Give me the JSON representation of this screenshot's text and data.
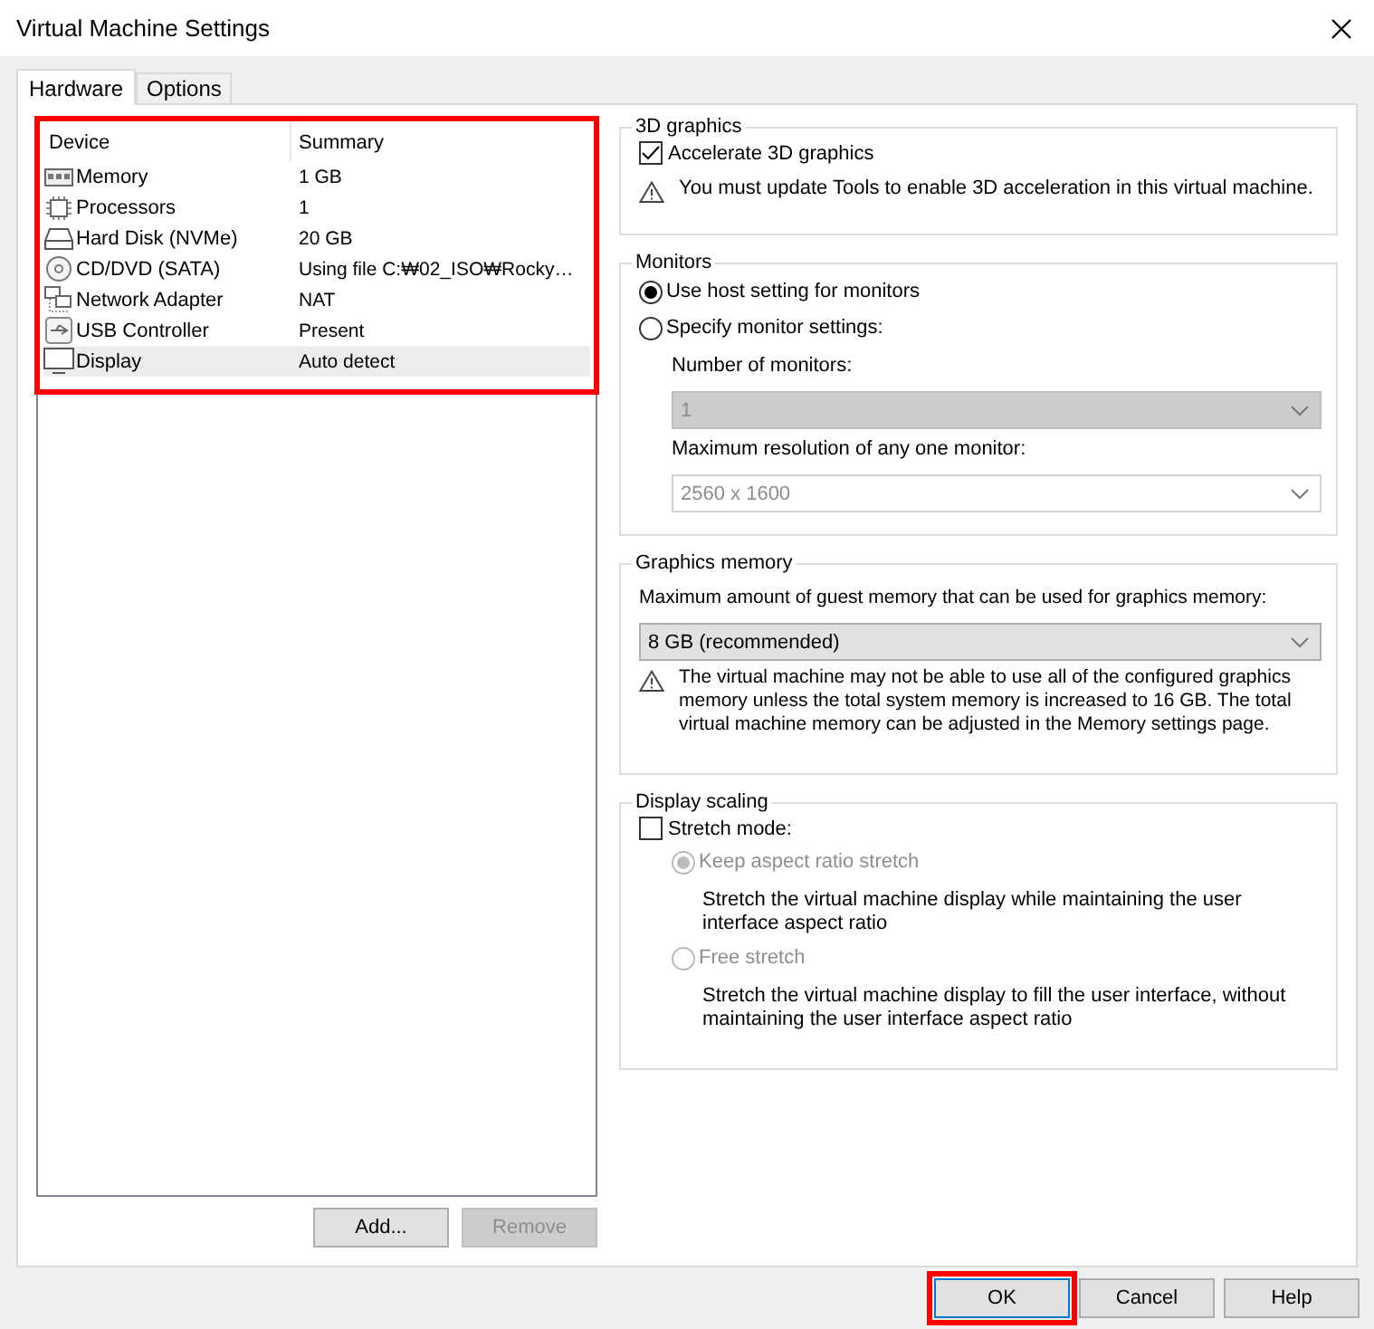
{
  "window": {
    "title": "Virtual Machine Settings"
  },
  "tabs": [
    {
      "label": "Hardware",
      "selected": true
    },
    {
      "label": "Options",
      "selected": false
    }
  ],
  "device_list": {
    "highlighted": true,
    "columns": [
      "Device",
      "Summary"
    ],
    "rows": [
      {
        "kind": "memory",
        "device": "Memory",
        "summary": "1 GB",
        "selected": false
      },
      {
        "kind": "processor",
        "device": "Processors",
        "summary": "1",
        "selected": false
      },
      {
        "kind": "disk",
        "device": "Hard Disk (NVMe)",
        "summary": "20 GB",
        "selected": false
      },
      {
        "kind": "cd",
        "device": "CD/DVD (SATA)",
        "summary": "Using file C:₩02_ISO₩Rocky…",
        "selected": false
      },
      {
        "kind": "network",
        "device": "Network Adapter",
        "summary": "NAT",
        "selected": false
      },
      {
        "kind": "usb",
        "device": "USB Controller",
        "summary": "Present",
        "selected": false
      },
      {
        "kind": "display",
        "device": "Display",
        "summary": "Auto detect",
        "selected": true
      }
    ]
  },
  "list_buttons": [
    {
      "label": "Add...",
      "disabled": false
    },
    {
      "label": "Remove",
      "disabled": true
    }
  ],
  "graphics_3d": {
    "title": "3D graphics",
    "accelerate": {
      "label": "Accelerate 3D graphics",
      "checked": true
    },
    "warning": "You must update Tools to enable 3D acceleration in this virtual machine."
  },
  "monitors": {
    "title": "Monitors",
    "options": [
      {
        "label": "Use host setting for monitors",
        "selected": true,
        "disabled": false
      },
      {
        "label": "Specify monitor settings:",
        "selected": false,
        "disabled": false
      }
    ],
    "fields": [
      {
        "label": "Number of monitors:",
        "kind": "list",
        "value": "1",
        "disabled": true
      },
      {
        "label": "Maximum resolution of any one monitor:",
        "kind": "combo",
        "value": "2560 x 1600",
        "disabled": true
      }
    ]
  },
  "graphics_memory": {
    "title": "Graphics memory",
    "label": "Maximum amount of guest memory that can be used for graphics memory:",
    "field": {
      "kind": "list",
      "value": "8 GB (recommended)",
      "disabled": false
    },
    "warning": "The virtual machine may not be able to use all of the configured graphics memory unless the total system memory is increased to 16 GB. The total virtual machine memory can be adjusted in the Memory settings page."
  },
  "display_scaling": {
    "title": "Display scaling",
    "stretch": {
      "label": "Stretch mode:",
      "checked": false
    },
    "options": [
      {
        "label": "Keep aspect ratio stretch",
        "selected": true,
        "disabled": true,
        "description": "Stretch the virtual machine display while maintaining the user interface aspect ratio"
      },
      {
        "label": "Free stretch",
        "selected": false,
        "disabled": true,
        "description": "Stretch the virtual machine display to fill the user interface, without maintaining the user interface aspect ratio"
      }
    ]
  },
  "dialog_buttons": [
    {
      "label": "OK",
      "highlighted": true
    },
    {
      "label": "Cancel",
      "highlighted": false
    },
    {
      "label": "Help",
      "highlighted": false
    }
  ]
}
